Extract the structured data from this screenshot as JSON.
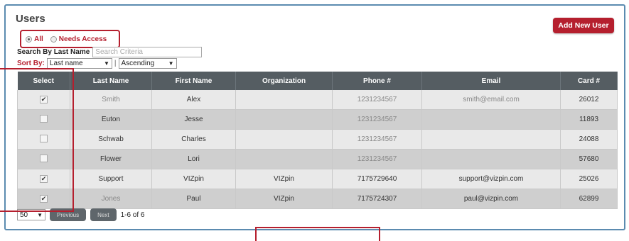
{
  "title": "Users",
  "filters": [
    {
      "label": "All",
      "selected": true
    },
    {
      "label": "Needs Access",
      "selected": false
    }
  ],
  "add_button": "Add New User",
  "search": {
    "label": "Search By Last Name",
    "placeholder": "Search Criteria"
  },
  "sort": {
    "label": "Sort By:",
    "field": "Last name",
    "separator": "|",
    "order": "Ascending"
  },
  "table": {
    "headers": [
      "Select",
      "Last Name",
      "First Name",
      "Organization",
      "Phone #",
      "Email",
      "Card #"
    ],
    "rows": [
      {
        "checked": true,
        "last": "Smith",
        "first": "Alex",
        "org": "",
        "phone": "1231234567",
        "email": "smith@email.com",
        "card": "26012"
      },
      {
        "checked": false,
        "last": "Euton",
        "first": "Jesse",
        "org": "",
        "phone": "1231234567",
        "email": "",
        "card": "11893"
      },
      {
        "checked": false,
        "last": "Schwab",
        "first": "Charles",
        "org": "",
        "phone": "1231234567",
        "email": "",
        "card": "24088"
      },
      {
        "checked": false,
        "last": "Flower",
        "first": "Lori",
        "org": "",
        "phone": "1231234567",
        "email": "",
        "card": "57680"
      },
      {
        "checked": true,
        "last": "Support",
        "first": "VIZpin",
        "org": "VIZpin",
        "phone": "7175729640",
        "email": "support@vizpin.com",
        "card": "25026"
      },
      {
        "checked": true,
        "last": "Jones",
        "first": "Paul",
        "org": "VIZpin",
        "phone": "7175724307",
        "email": "paul@vizpin.com",
        "card": "62899"
      }
    ]
  },
  "pager": {
    "page_size": "50",
    "prev": "Previous",
    "next": "Next",
    "range": "1-6 of 6"
  },
  "colors": {
    "accent": "#b51f2e",
    "header_bg": "#555d62",
    "panel_border": "#5b8bb0"
  }
}
